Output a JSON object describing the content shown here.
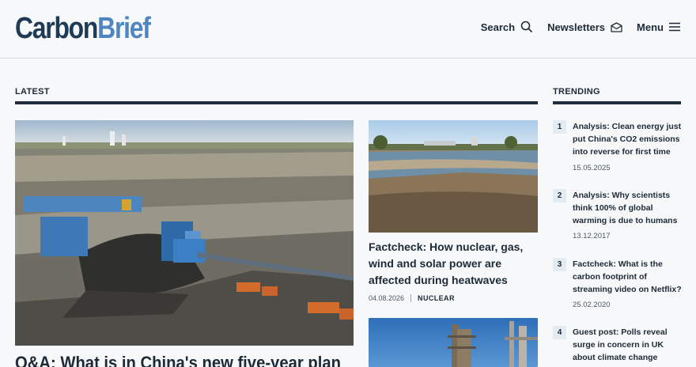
{
  "header": {
    "logo_part1": "Carbon",
    "logo_part2": "Brief",
    "nav": {
      "search": "Search",
      "newsletters": "Newsletters",
      "menu": "Menu"
    }
  },
  "latest": {
    "heading": "LATEST",
    "feature": {
      "title": "Q&A: What is in China's new five-year plan",
      "image": "coal-mine-photo"
    },
    "card": {
      "title": "Factcheck: How nuclear, gas, wind and solar power are affected during heatwaves",
      "date": "04.08.2026",
      "tag": "NUCLEAR",
      "image": "dry-riverbed-photo"
    },
    "card2": {
      "image": "industrial-plant-photo"
    }
  },
  "trending": {
    "heading": "TRENDING",
    "items": [
      {
        "num": "1",
        "title": "Analysis: Clean energy just put China's CO2 emissions into reverse for first time",
        "date": "15.05.2025"
      },
      {
        "num": "2",
        "title": "Analysis: Why scientists think 100% of global warming is due to humans",
        "date": "13.12.2017"
      },
      {
        "num": "3",
        "title": "Factcheck: What is the carbon footprint of streaming video on Netflix?",
        "date": "25.02.2020"
      },
      {
        "num": "4",
        "title": "Guest post: Polls reveal surge in concern in UK about climate change",
        "date": ""
      }
    ]
  }
}
